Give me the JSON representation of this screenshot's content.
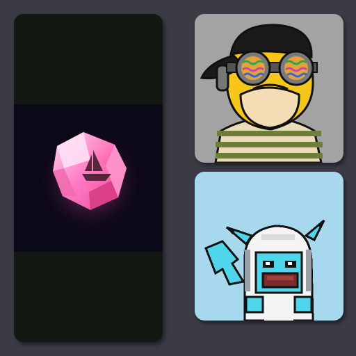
{
  "gallery": {
    "cards": [
      {
        "name": "gem-card",
        "icon": "pink-crystal-gem-with-ship-icon",
        "background": "#121812",
        "band": "#0b0818"
      },
      {
        "name": "duck-avatar-card",
        "icon": "yellow-duck-with-goggles-and-cap-icon",
        "background": "#a3a3a3"
      },
      {
        "name": "pixel-avatar-card",
        "icon": "pixel-cyan-creature-in-white-hood-icon",
        "background": "#a8d8ee"
      }
    ]
  },
  "colors": {
    "page_background": "#3b3b45",
    "gem_pink": "#ff7ac8",
    "duck_yellow": "#f6c71a",
    "shirt_green": "#6f7f3a",
    "shirt_cream": "#e9dcb6",
    "pixel_cyan": "#4fd6ea"
  }
}
